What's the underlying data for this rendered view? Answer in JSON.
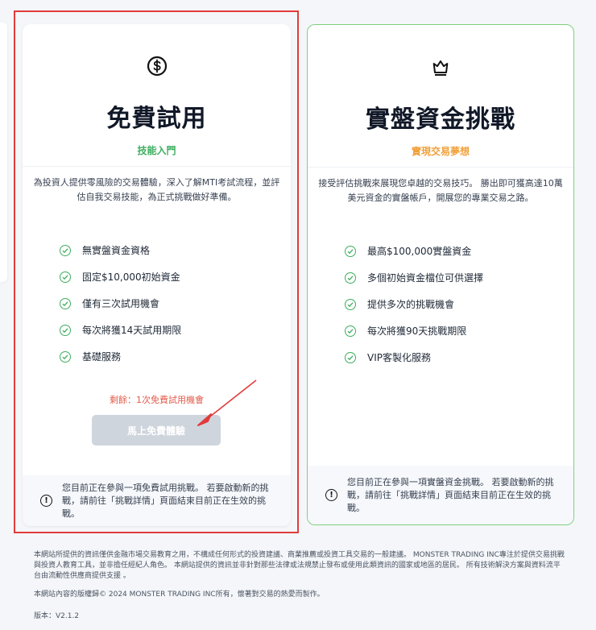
{
  "colors": {
    "accent_green": "#3dae5e",
    "accent_orange": "#f0a03a",
    "alert_red": "#e23b3b"
  },
  "cards": [
    {
      "icon": "dollar-coin-icon",
      "title": "免費試用",
      "subtitle": "技能入門",
      "description": "為投資人提供零風險的交易體驗，深入了解MTI考試流程，並評估自我交易技能，為正式挑戰做好準備。",
      "features": [
        "無實盤資金資格",
        "固定$10,000初始資金",
        "僅有三次試用機會",
        "每次將獲14天試用期限",
        "基礎服務"
      ],
      "remaining": "剩餘：1次免費試用機會",
      "button_label": "馬上免費體驗",
      "notice": "您目前正在參與一項免費試用挑戰。 若要啟動新的挑戰，請前往「挑戰詳情」頁面結束目前正在生效的挑戰。"
    },
    {
      "icon": "crown-icon",
      "title": "實盤資金挑戰",
      "subtitle": "實現交易夢想",
      "description": "接受評估挑戰來展現您卓越的交易技巧。 勝出即可獲高達10萬美元資金的實盤帳戶，開展您的專業交易之路。",
      "features": [
        "最高$100,000實盤資金",
        "多個初始資金檔位可供選擇",
        "提供多次的挑戰機會",
        "每次將獲90天挑戰期限",
        "VIP客製化服務"
      ],
      "notice": "您目前正在參與一項實盤資金挑戰。 若要啟動新的挑戰，請前往「挑戰詳情」頁面結束目前正在生效的挑戰。"
    }
  ],
  "footer": {
    "disclaimer": "本網站所提供的資訊僅供金融市場交易教育之用，不構成任何形式的投資建議、商業推薦或投資工具交易的一般建議。 MONSTER TRADING INC專注於提供交易挑戰與投資人教育工具，並非擔任經紀人角色。 本網站提供的資訊並非針對那些法律或法規禁止發布或使用此類資訊的國家或地區的居民。 所有技術解決方案與資料流平台由流動性供應商提供支援 。",
    "copyright": "本網站內容的版權歸© 2024 MONSTER TRADING INC所有，懷著對交易的熱愛而製作。",
    "version": "版本：V2.1.2"
  }
}
